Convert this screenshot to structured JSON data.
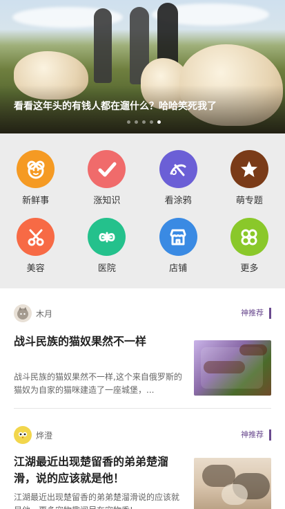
{
  "banner": {
    "caption": "看看这年头的有钱人都在遛什么？哈哈笑死我了",
    "dots_count": 5,
    "active_dot_index": 4
  },
  "categories": [
    {
      "label": "新鲜事",
      "icon": "bear-face-icon",
      "color": "#f59a23"
    },
    {
      "label": "涨知识",
      "icon": "checkmark-icon",
      "color": "#f06b6b"
    },
    {
      "label": "看涂鸦",
      "icon": "paint-brush-icon",
      "color": "#6b5fd6"
    },
    {
      "label": "萌专题",
      "icon": "star-icon",
      "color": "#7a3b18"
    },
    {
      "label": "美容",
      "icon": "scissors-icon",
      "color": "#f76a45"
    },
    {
      "label": "医院",
      "icon": "medical-cross-icon",
      "color": "#24c18c"
    },
    {
      "label": "店铺",
      "icon": "store-icon",
      "color": "#3a8ae3"
    },
    {
      "label": "更多",
      "icon": "grid-icon",
      "color": "#8ac82a"
    }
  ],
  "feed": [
    {
      "author": "木月",
      "avatar": "cat-avatar-icon",
      "tag": "神推荐",
      "title": "战斗民族的猫奴果然不一样",
      "desc": "战斗民族的猫奴果然不一样,这个来自俄罗斯的猫奴为自家的猫咪建造了一座城堡，..."
    },
    {
      "author": "烨澄",
      "avatar": "owl-avatar-icon",
      "tag": "神推荐",
      "title": "江湖最近出现楚留香的弟弟楚溜滑，说的应该就是他！",
      "desc": "江湖最近出现楚留香的弟弟楚溜滑说的应该就是他，更多宠物趣闻尽在宠物秀!"
    }
  ]
}
